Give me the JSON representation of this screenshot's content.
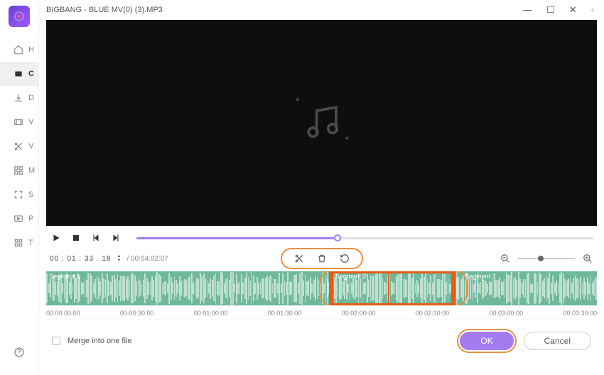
{
  "titlebar": {
    "title": "BIGBANG - BLUE MV(0) (3).MP3"
  },
  "sidebar": {
    "items": [
      {
        "icon": "home",
        "label": "H"
      },
      {
        "icon": "convert",
        "label": "C"
      },
      {
        "icon": "download",
        "label": "D"
      },
      {
        "icon": "video",
        "label": "V"
      },
      {
        "icon": "cut",
        "label": "V"
      },
      {
        "icon": "merge",
        "label": "M"
      },
      {
        "icon": "screen",
        "label": "S"
      },
      {
        "icon": "play",
        "label": "P"
      },
      {
        "icon": "tools",
        "label": "T"
      }
    ]
  },
  "playback": {
    "current_time": "00 : 01 : 33 . 18",
    "duration": "/ 00:04:02:07",
    "progress_pct": 44
  },
  "segments": {
    "labels": [
      "Segment 1",
      "Segment 2",
      "Segment 3"
    ]
  },
  "ruler": {
    "ticks": [
      "00:00:00:00",
      "00:00:30:00",
      "00:01:00:00",
      "00:01:30:00",
      "00:02:00:00",
      "00:02:30:00",
      "00:03:00:00",
      "00:03:30:00"
    ]
  },
  "footer": {
    "merge_label": "Merge into one file",
    "ok": "OK",
    "cancel": "Cancel"
  }
}
